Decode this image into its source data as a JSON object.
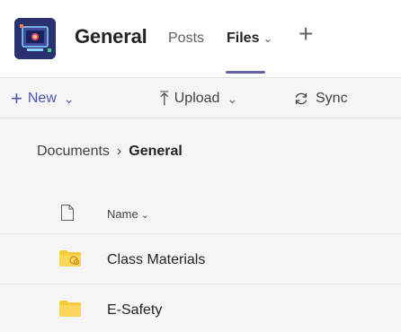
{
  "header": {
    "channel_title": "General",
    "tabs": [
      {
        "label": "Posts"
      },
      {
        "label": "Files",
        "chevron": "⌄"
      }
    ],
    "add_tab": "+"
  },
  "toolbar": {
    "new": {
      "glyph": "+",
      "label": "New",
      "chevron": "⌄"
    },
    "upload": {
      "glyph": "⤒",
      "label": "Upload",
      "chevron": "⌄"
    },
    "sync": {
      "label": "Sync",
      "icon": "sync-icon"
    }
  },
  "breadcrumb": {
    "root": "Documents",
    "separator": "›",
    "current": "General"
  },
  "list": {
    "column_name": "Name",
    "column_chevron": "⌄",
    "items": [
      {
        "name": "Class Materials",
        "icon": "shared-folder-icon"
      },
      {
        "name": "E-Safety",
        "icon": "folder-icon"
      }
    ]
  },
  "colors": {
    "accent": "#6264a7",
    "accent_text": "#4f52b2",
    "folder": "#f8c938",
    "logo_bg": "#2a3170"
  }
}
